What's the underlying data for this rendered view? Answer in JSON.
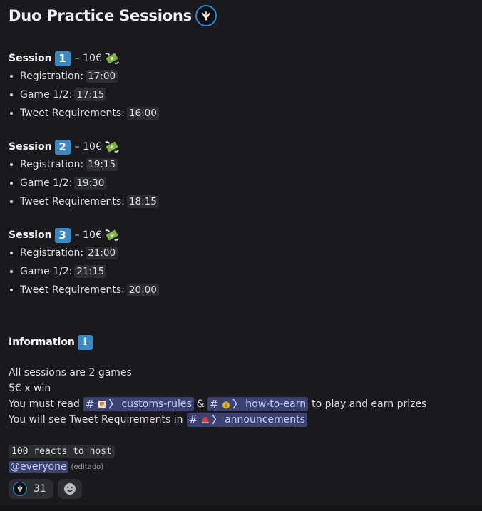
{
  "title": "Duo Practice Sessions",
  "sessions": [
    {
      "label": "Session",
      "number": "1",
      "price": "– 10€",
      "items": [
        {
          "label": "Registration:",
          "time": "17:00"
        },
        {
          "label": "Game 1/2:",
          "time": "17:15"
        },
        {
          "label": "Tweet Requirements:",
          "time": "16:00"
        }
      ]
    },
    {
      "label": "Session",
      "number": "2",
      "price": "– 10€",
      "items": [
        {
          "label": "Registration:",
          "time": "19:15"
        },
        {
          "label": "Game 1/2:",
          "time": "19:30"
        },
        {
          "label": "Tweet Requirements:",
          "time": "18:15"
        }
      ]
    },
    {
      "label": "Session",
      "number": "3",
      "price": "– 10€",
      "items": [
        {
          "label": "Registration:",
          "time": "21:00"
        },
        {
          "label": "Game 1/2:",
          "time": "21:15"
        },
        {
          "label": "Tweet Requirements:",
          "time": "20:00"
        }
      ]
    }
  ],
  "information": {
    "heading": "Information",
    "icon_letter": "i",
    "line1": "All sessions are 2 games",
    "line2": "5€ x win",
    "line3_prefix": "You must read",
    "channel_rules": "customs-rules",
    "amp": "&",
    "channel_earn": "how-to-earn",
    "line3_suffix": "to play and earn prizes",
    "line4_prefix": "You will see Tweet Requirements in",
    "channel_announce": "announcements"
  },
  "footer": {
    "code": "100 reacts to host",
    "mention": "@everyone",
    "edited": "(editado)"
  },
  "reactions": [
    {
      "emoji": "server-logo-icon",
      "count": "31"
    }
  ],
  "colors": {
    "accent": "#3b88c3",
    "mention_bg": "#3c4270",
    "mention_text": "#c9cdfb",
    "background": "#1a1a1e"
  }
}
